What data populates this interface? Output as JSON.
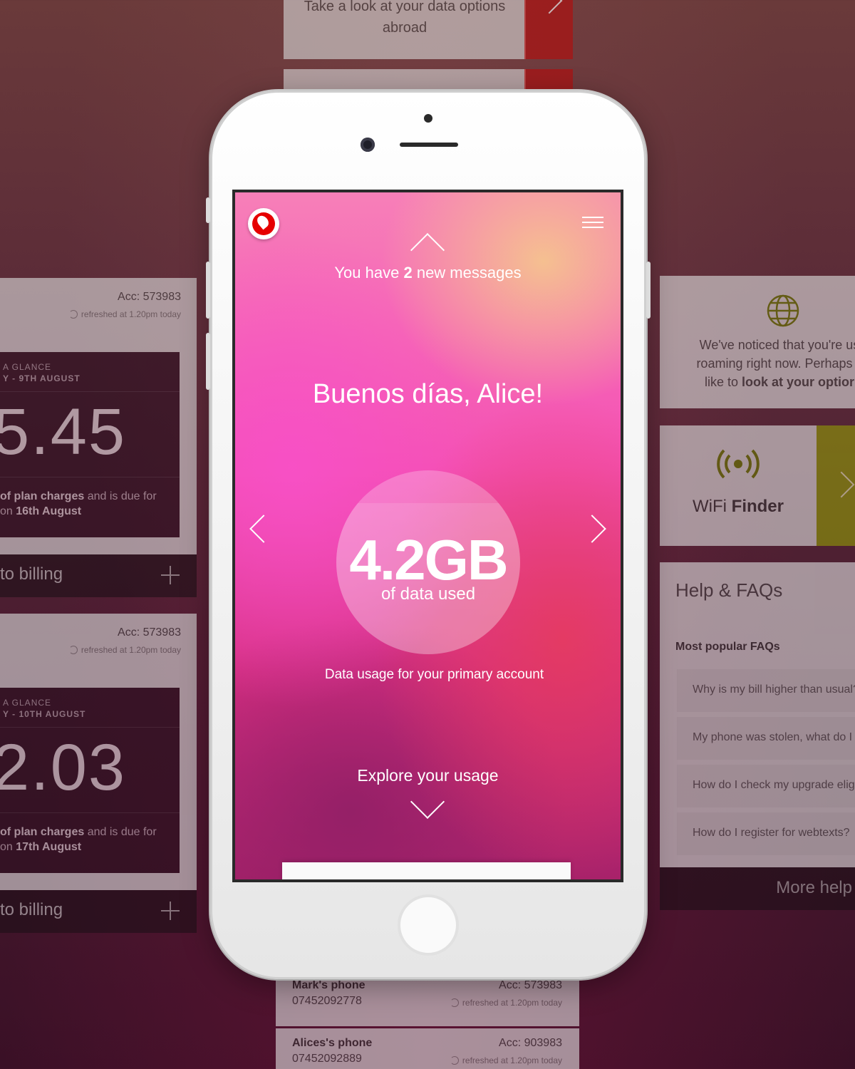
{
  "top_card": {
    "line1": "Take a look at your data options",
    "line2": "abroad"
  },
  "bill_cards": [
    {
      "acc": "Acc: 573983",
      "refreshed": "refreshed at 1.20pm today",
      "glance": "A GLANCE",
      "date": "Y - 9TH AUGUST",
      "amount": "5.45",
      "desc_bold": "of plan charges",
      "desc_rest": " and is due for",
      "due_prefix": "on ",
      "due_date": "16th August",
      "footer": "to billing"
    },
    {
      "acc": "Acc: 573983",
      "refreshed": "refreshed at 1.20pm today",
      "glance": "A GLANCE",
      "date": "Y - 10TH AUGUST",
      "amount": "2.03",
      "desc_bold": "of plan charges",
      "desc_rest": " and is due for",
      "due_prefix": "on ",
      "due_date": "17th August",
      "footer": "to billing"
    }
  ],
  "roaming_card": {
    "line1": "We've noticed that you're us",
    "line2": "roaming right now. Perhaps y",
    "line3_prefix": "like to ",
    "line3_bold": "look at your optior"
  },
  "wifi_card": {
    "label_prefix": "WiFi ",
    "label_bold": "Finder",
    "accent": "#8f9a07"
  },
  "faq_card": {
    "title": "Help & FAQs",
    "subtitle": "Most popular FAQs",
    "items": [
      "Why is my bill higher than usual?",
      "My phone was stolen, what do I d",
      "How do I check my upgrade elig",
      "How do I register for webtexts?"
    ],
    "more": "More help"
  },
  "device_cards": [
    {
      "name": "Mark's phone",
      "number": "07452092778",
      "acc": "Acc: 573983",
      "refreshed": "refreshed at 1.20pm today"
    },
    {
      "name": "Alices's phone",
      "number": "07452092889",
      "acc": "Acc: 903983",
      "refreshed": "refreshed at 1.20pm today"
    }
  ],
  "app": {
    "brand": "vodafone-logo",
    "messages_prefix": "You have ",
    "messages_count": "2",
    "messages_suffix": " new messages",
    "greeting_prefix": "Buenos días, ",
    "greeting_name": "Alice!",
    "usage_value": "4.2GB",
    "usage_label": "of data used",
    "usage_fill_fraction": 0.82,
    "usage_caption": "Data usage for your primary account",
    "explore": "Explore your usage",
    "brand_color": "#e60000"
  }
}
